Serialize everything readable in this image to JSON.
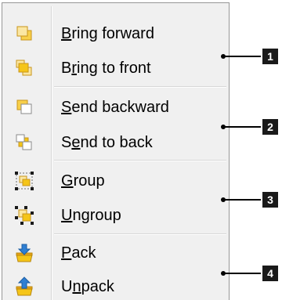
{
  "menu": {
    "items": [
      {
        "pre": "",
        "mnemonic": "B",
        "post": "ring forward",
        "icon": "bring-forward-icon"
      },
      {
        "pre": "B",
        "mnemonic": "r",
        "post": "ing to front",
        "icon": "bring-to-front-icon"
      },
      {
        "pre": "",
        "mnemonic": "S",
        "post": "end backward",
        "icon": "send-backward-icon"
      },
      {
        "pre": "S",
        "mnemonic": "e",
        "post": "nd to back",
        "icon": "send-to-back-icon"
      },
      {
        "pre": "",
        "mnemonic": "G",
        "post": "roup",
        "icon": "group-icon"
      },
      {
        "pre": "",
        "mnemonic": "U",
        "post": "ngroup",
        "icon": "ungroup-icon"
      },
      {
        "pre": "",
        "mnemonic": "P",
        "post": "ack",
        "icon": "pack-icon"
      },
      {
        "pre": "U",
        "mnemonic": "n",
        "post": "pack",
        "icon": "unpack-icon"
      }
    ]
  },
  "callouts": [
    "1",
    "2",
    "3",
    "4"
  ],
  "colors": {
    "menu_background": "#f0f0f0",
    "menu_border": "#979797",
    "icon_yellow": "#f5c518",
    "icon_orange": "#e8a317",
    "icon_blue": "#2f7fd3",
    "badge": "#1a1a1a"
  }
}
